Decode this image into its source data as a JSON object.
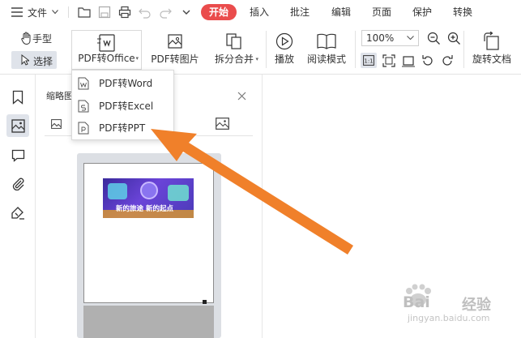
{
  "menubar": {
    "file_label": "文件",
    "tabs": [
      "开始",
      "插入",
      "批注",
      "编辑",
      "页面",
      "保护",
      "转换"
    ],
    "active_tab": "开始",
    "active_color": "#ea4c4c"
  },
  "ribbon": {
    "hand_tool": "手型",
    "select_tool": "选择",
    "pdf_to_office": "PDF转Office",
    "pdf_to_image": "PDF转图片",
    "split_merge": "拆分合并",
    "play": "播放",
    "read_mode": "阅读模式",
    "zoom_value": "100%",
    "rotate_doc": "旋转文档"
  },
  "dropdown": {
    "items": [
      {
        "label": "PDF转Word",
        "icon": "word-file-icon"
      },
      {
        "label": "PDF转Excel",
        "icon": "excel-file-icon"
      },
      {
        "label": "PDF转PPT",
        "icon": "ppt-file-icon"
      }
    ]
  },
  "thumbnail_panel": {
    "title": "缩略图",
    "banner_text": "新的旅途 新的起点"
  },
  "watermark": {
    "brand": "Bai",
    "brand2": "经验",
    "url": "jingyan.baidu.com"
  },
  "colors": {
    "arrow": "#f0802a",
    "highlight": "#dfe3ea"
  }
}
